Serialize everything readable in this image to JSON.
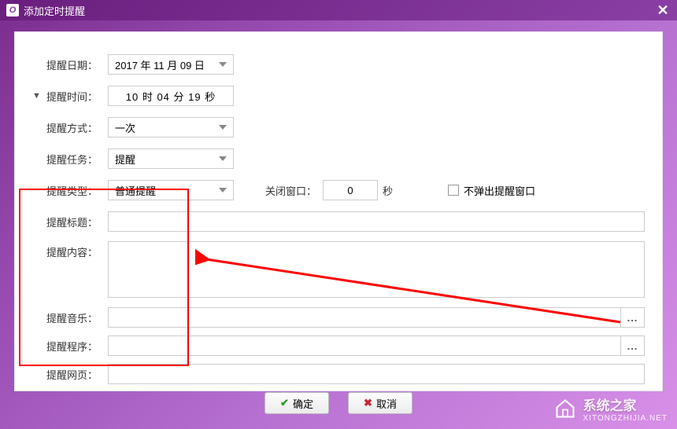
{
  "window": {
    "title": "添加定时提醒"
  },
  "labels": {
    "date": "提醒日期：",
    "time": "提醒时间：",
    "mode": "提醒方式：",
    "task": "提醒任务：",
    "type": "提醒类型：",
    "closeWindow": "关闭窗口：",
    "seconds": "秒",
    "noPopup": "不弹出提醒窗口",
    "title": "提醒标题：",
    "content": "提醒内容：",
    "music": "提醒音乐：",
    "program": "提醒程序：",
    "webpage": "提醒网页："
  },
  "values": {
    "date": "2017 年 11 月 09 日",
    "time": "10 时 04 分 19 秒",
    "mode": "一次",
    "task": "提醒",
    "type": "普通提醒",
    "closeSeconds": "0",
    "title": "",
    "content": "",
    "music": "",
    "program": "",
    "webpage": ""
  },
  "buttons": {
    "ok": "确定",
    "cancel": "取消",
    "browse": "..."
  },
  "watermark": {
    "text": "系统之家",
    "url": "XITONGZHIJIA.NET"
  }
}
